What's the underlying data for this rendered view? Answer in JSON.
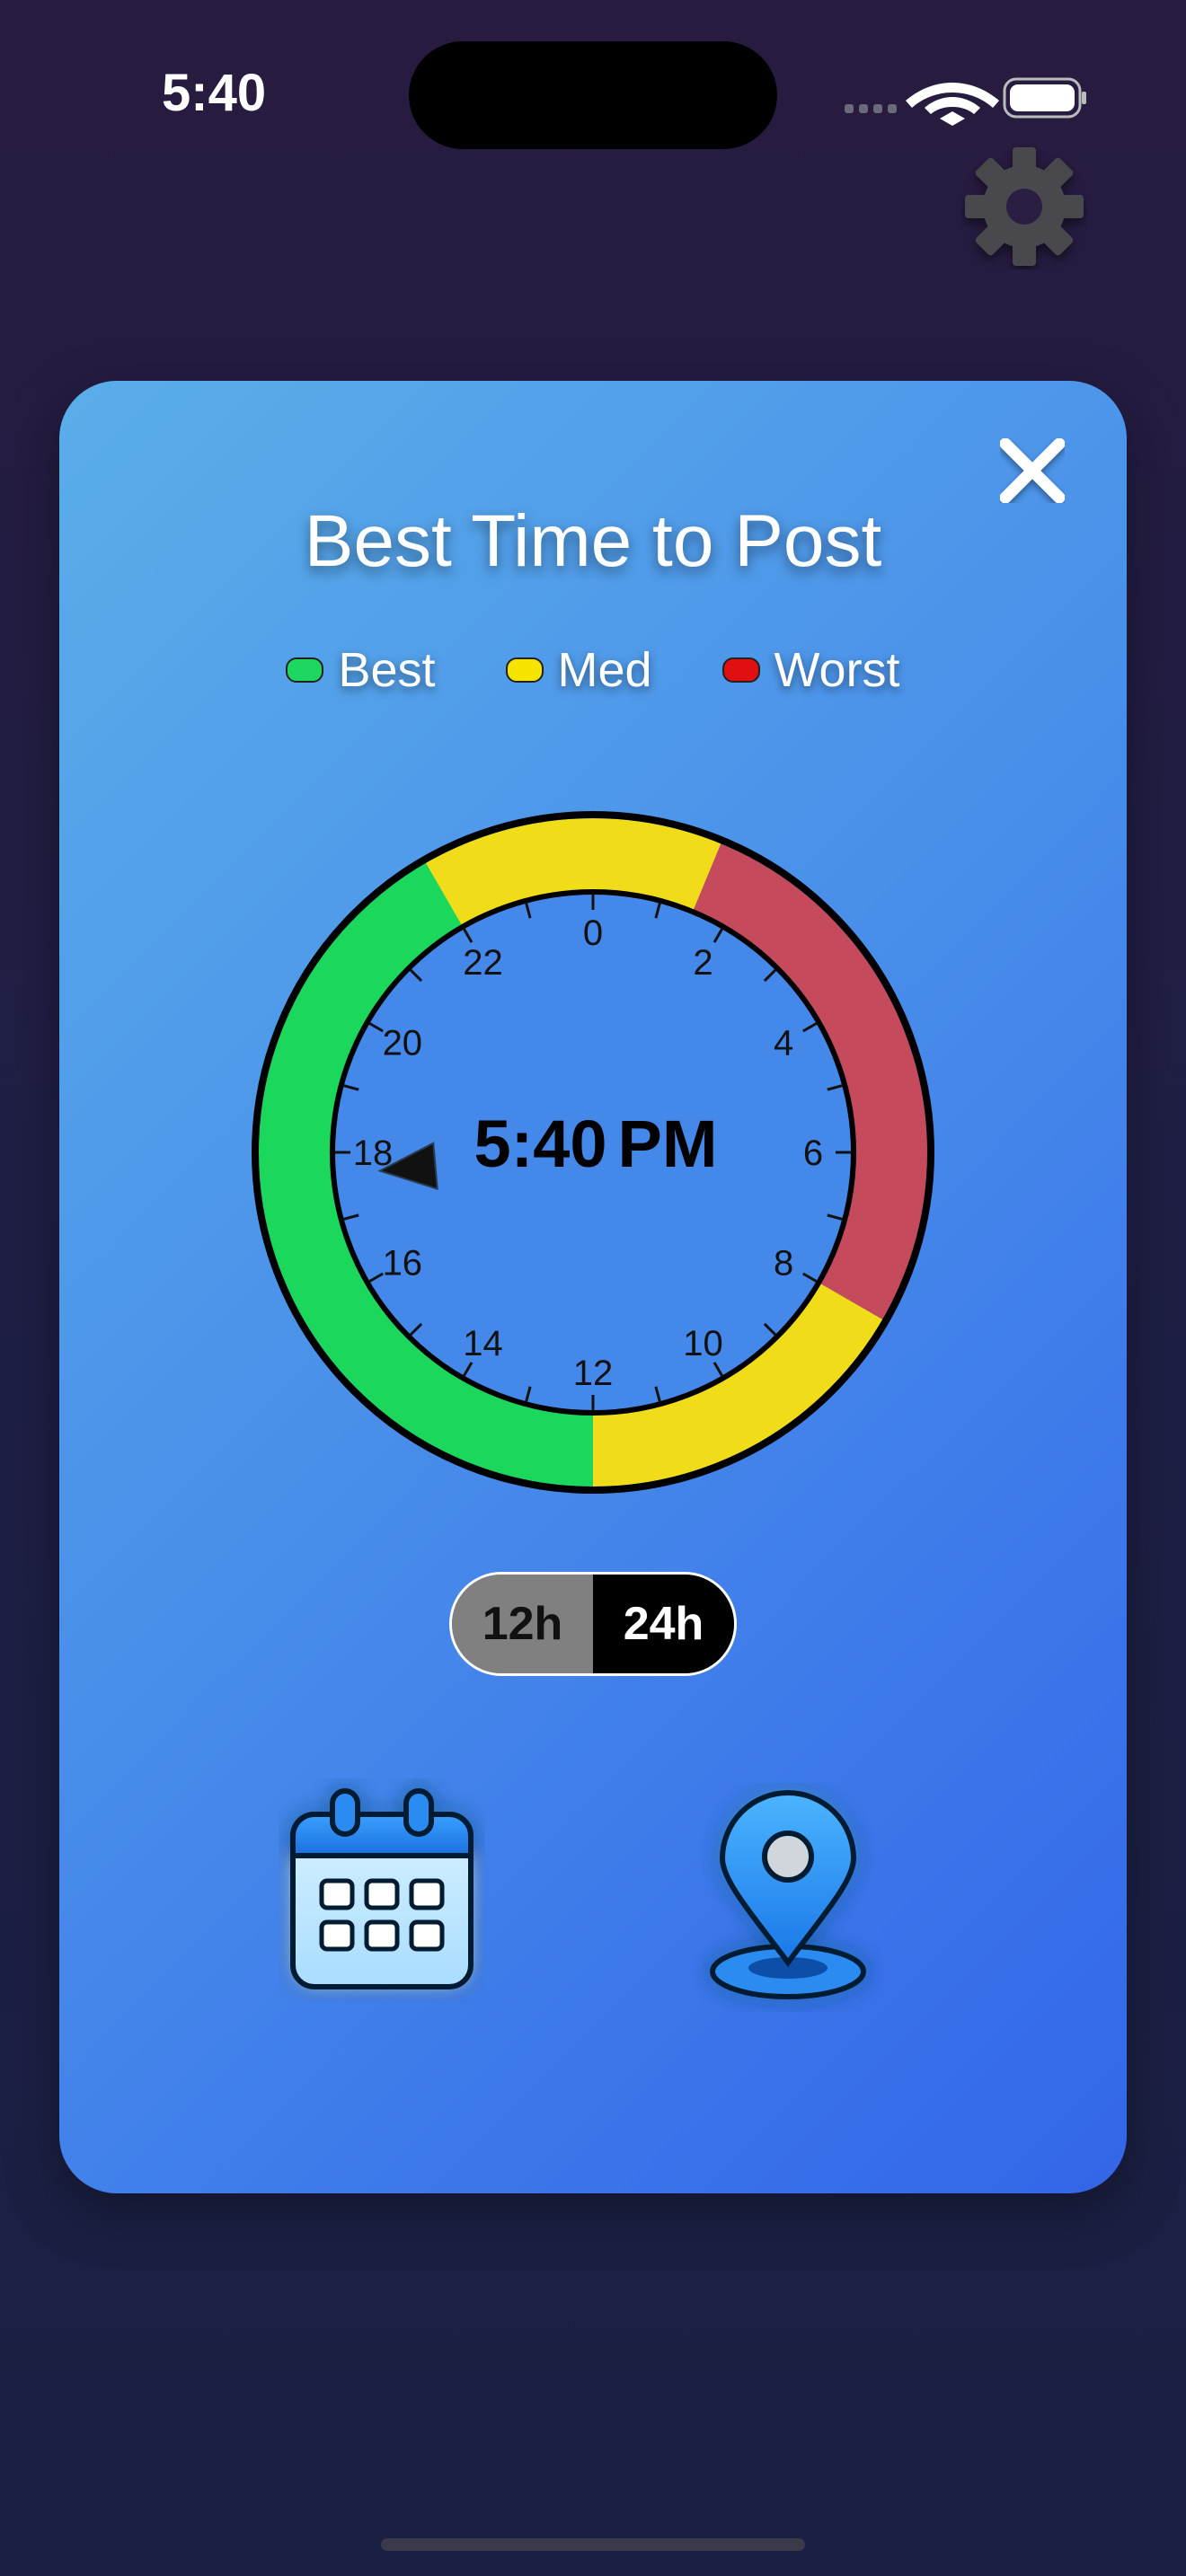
{
  "status_bar": {
    "time": "5:40"
  },
  "modal": {
    "title": "Best Time to Post",
    "legend": [
      {
        "label": "Best",
        "color": "#1ed760"
      },
      {
        "label": "Med",
        "color": "#f4e400"
      },
      {
        "label": "Worst",
        "color": "#e01010"
      }
    ]
  },
  "clock": {
    "readout_time": "5:40",
    "readout_period": "PM",
    "hour_labels": [
      "0",
      "2",
      "4",
      "6",
      "8",
      "10",
      "12",
      "14",
      "16",
      "18",
      "20",
      "22"
    ],
    "current_hour": 17.67,
    "segments": [
      {
        "from": 12,
        "to": 24,
        "quality": "best",
        "color": "#1bd85c"
      },
      {
        "from": 22,
        "to": 1.5,
        "quality": "med",
        "color": "#f0dc18"
      },
      {
        "from": 1.5,
        "to": 8,
        "quality": "worst",
        "color": "#c44a5c"
      },
      {
        "from": 8,
        "to": 12,
        "quality": "med",
        "color": "#f0dc18"
      }
    ]
  },
  "format_toggle": {
    "option_12h": "12h",
    "option_24h": "24h",
    "selected": "24h"
  },
  "colors": {
    "accent": "#3c78ea",
    "background": "#241c40"
  }
}
